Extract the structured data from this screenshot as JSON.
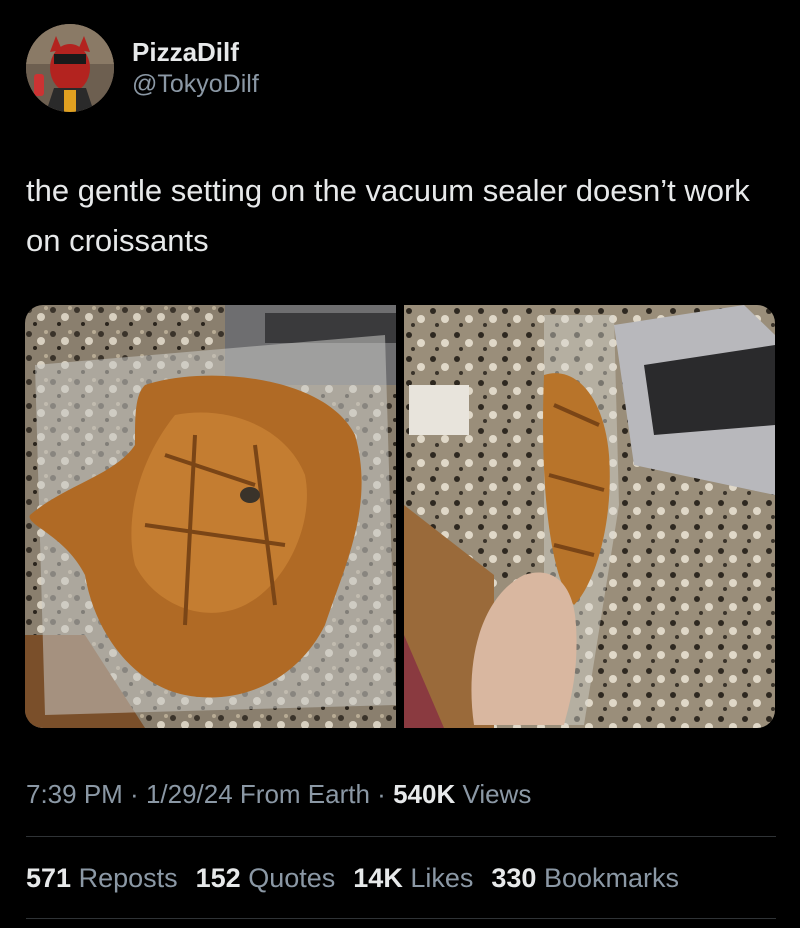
{
  "author": {
    "display_name": "PizzaDilf",
    "handle": "@TokyoDilf"
  },
  "tweet": {
    "text": "the gentle setting on the vacuum sealer doesn’t work on croissants"
  },
  "media": {
    "left_photo": "vacuum-sealed flattened croissant on granite countertop",
    "right_photo": "hand holding vacuum-sealed croissant next to vacuum sealer"
  },
  "meta": {
    "time": "7:39 PM",
    "separator": " · ",
    "date": "1/29/24",
    "source": "From Earth",
    "views_count": "540K",
    "views_label": "Views"
  },
  "stats": {
    "reposts_count": "571",
    "reposts_label": "Reposts",
    "quotes_count": "152",
    "quotes_label": "Quotes",
    "likes_count": "14K",
    "likes_label": "Likes",
    "bookmarks_count": "330",
    "bookmarks_label": "Bookmarks"
  },
  "colors": {
    "background": "#000000",
    "text_primary": "#e7e9ea",
    "text_secondary": "#8b98a5",
    "divider": "#2f3336"
  }
}
